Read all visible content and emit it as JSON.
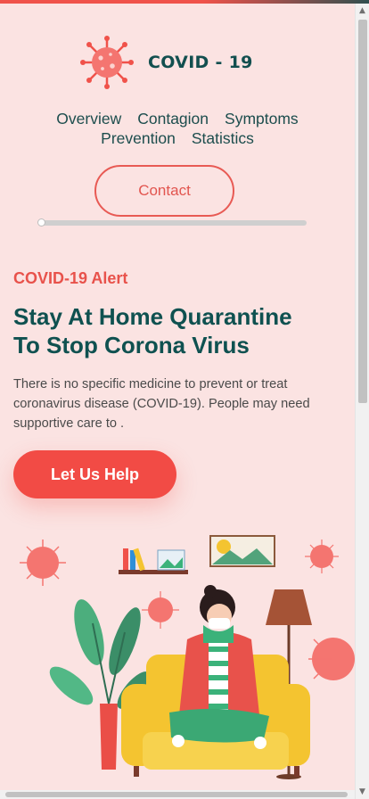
{
  "brand": {
    "name": "COVID - 19",
    "logo_icon": "virus-icon",
    "accent": "#f0524a",
    "dark": "#124f4f"
  },
  "nav": {
    "row1": [
      "Overview",
      "Contagion",
      "Symptoms"
    ],
    "row2": [
      "Prevention",
      "Statistics"
    ]
  },
  "contact": {
    "label": "Contact"
  },
  "hero": {
    "alert": "COVID-19 Alert",
    "headline_line1": "Stay At Home Quarantine",
    "headline_line2": "To Stop Corona Virus",
    "body": "There is no specific medicine to prevent or treat coronavirus disease (COVID-19). People may need supportive care to .",
    "cta": "Let Us Help"
  },
  "illustration": {
    "name": "woman-in-mask-on-sofa-illustration"
  },
  "scrollbars": {
    "up": "▲",
    "down": "▼"
  }
}
